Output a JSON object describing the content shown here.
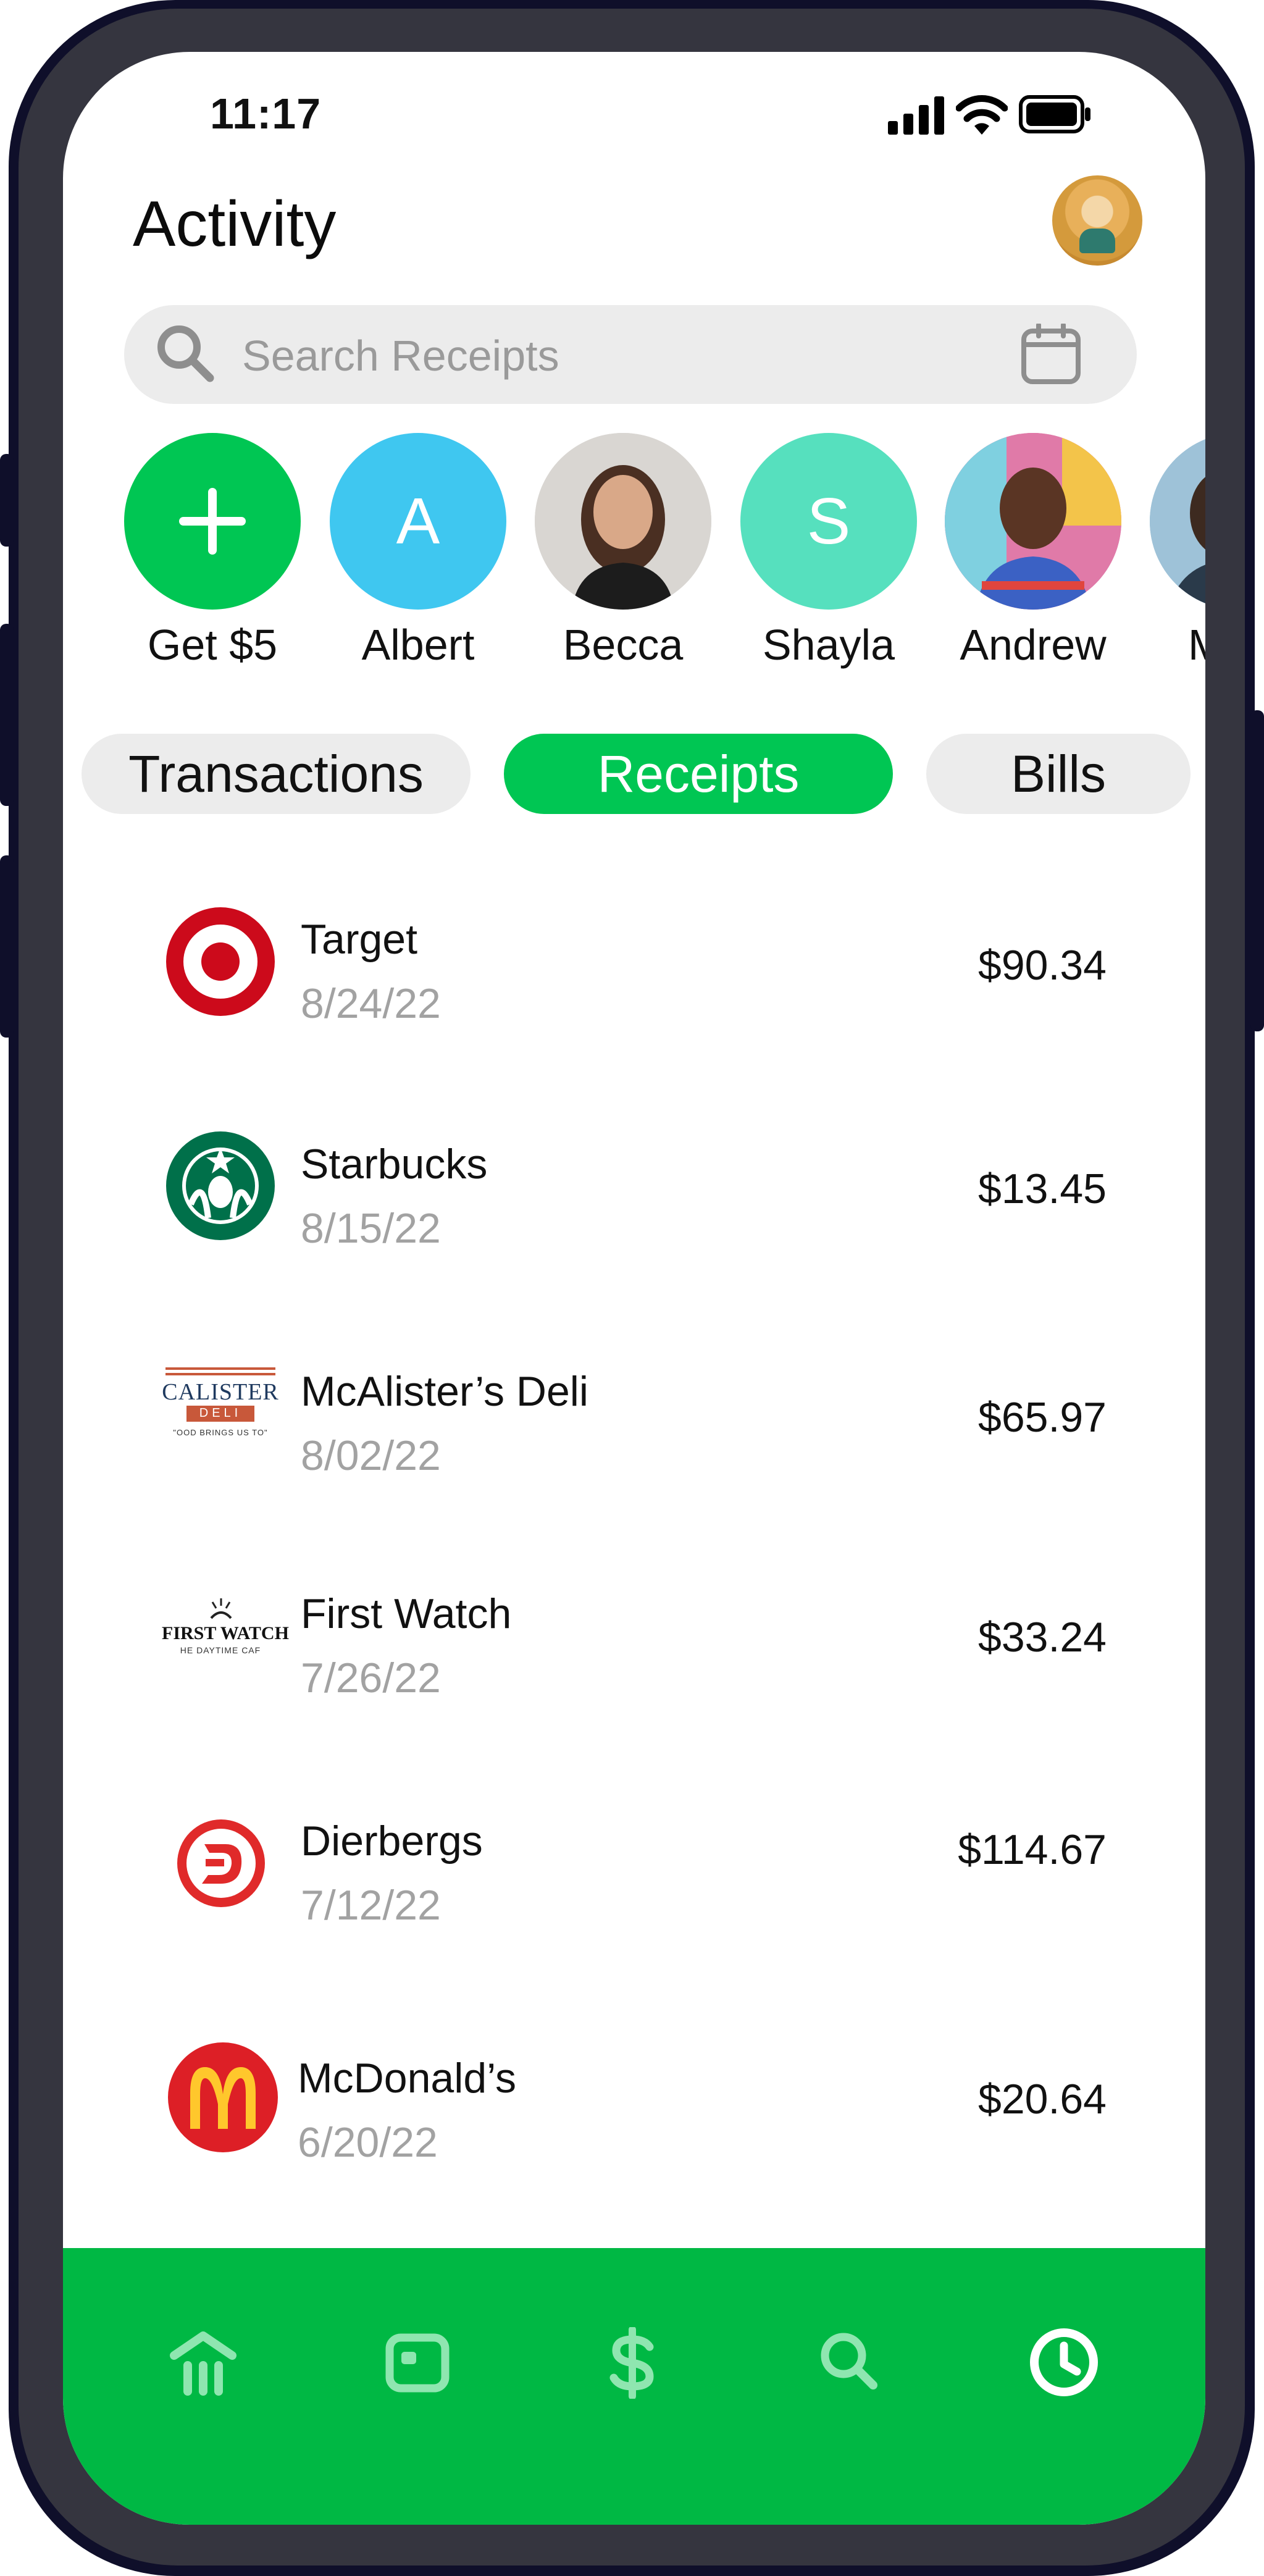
{
  "status_bar": {
    "time": "11:17"
  },
  "header": {
    "title": "Activity"
  },
  "search": {
    "placeholder": "Search Receipts"
  },
  "contacts": [
    {
      "label": "Get $5",
      "initial": "+",
      "color": "#00c653"
    },
    {
      "label": "Albert",
      "initial": "A",
      "color": "#3fc7f0"
    },
    {
      "label": "Becca",
      "initial": "",
      "color": "#d9d6d2"
    },
    {
      "label": "Shayla",
      "initial": "S",
      "color": "#56e0be"
    },
    {
      "label": "Andrew",
      "initial": "",
      "color": "#e07aa8"
    },
    {
      "label": "M",
      "initial": "",
      "color": "#9ec2d8"
    }
  ],
  "tabs": [
    {
      "label": "Transactions",
      "active": false
    },
    {
      "label": "Receipts",
      "active": true
    },
    {
      "label": "Bills",
      "active": false
    }
  ],
  "receipts": [
    {
      "merchant": "Target",
      "date": "8/24/22",
      "amount": "$90.34",
      "logo": "target-logo"
    },
    {
      "merchant": "Starbucks",
      "date": "8/15/22",
      "amount": "$13.45",
      "logo": "starbucks-logo"
    },
    {
      "merchant": "McAlister’s Deli",
      "date": "8/02/22",
      "amount": "$65.97",
      "logo": "mcalisters-logo",
      "logo_text": "CALISTER",
      "logo_sub": "DELI",
      "logo_tag": "\"OOD BRINGS US TO\""
    },
    {
      "merchant": "First Watch",
      "date": "7/26/22",
      "amount": "$33.24",
      "logo": "first-watch-logo",
      "logo_text": "FIRST WATCH",
      "logo_tag": "HE DAYTIME CAF"
    },
    {
      "merchant": "Dierbergs",
      "date": "7/12/22",
      "amount": "$114.67",
      "logo": "dierbergs-logo"
    },
    {
      "merchant": "McDonald’s",
      "date": "6/20/22",
      "amount": "$20.64",
      "logo": "mcdonalds-logo"
    }
  ],
  "bottom_nav": [
    {
      "name": "home-icon"
    },
    {
      "name": "card-icon"
    },
    {
      "name": "dollar-icon"
    },
    {
      "name": "search-icon"
    },
    {
      "name": "clock-icon"
    }
  ],
  "colors": {
    "accent": "#00b844",
    "tab_active": "#00c653",
    "pill": "#ececec"
  }
}
